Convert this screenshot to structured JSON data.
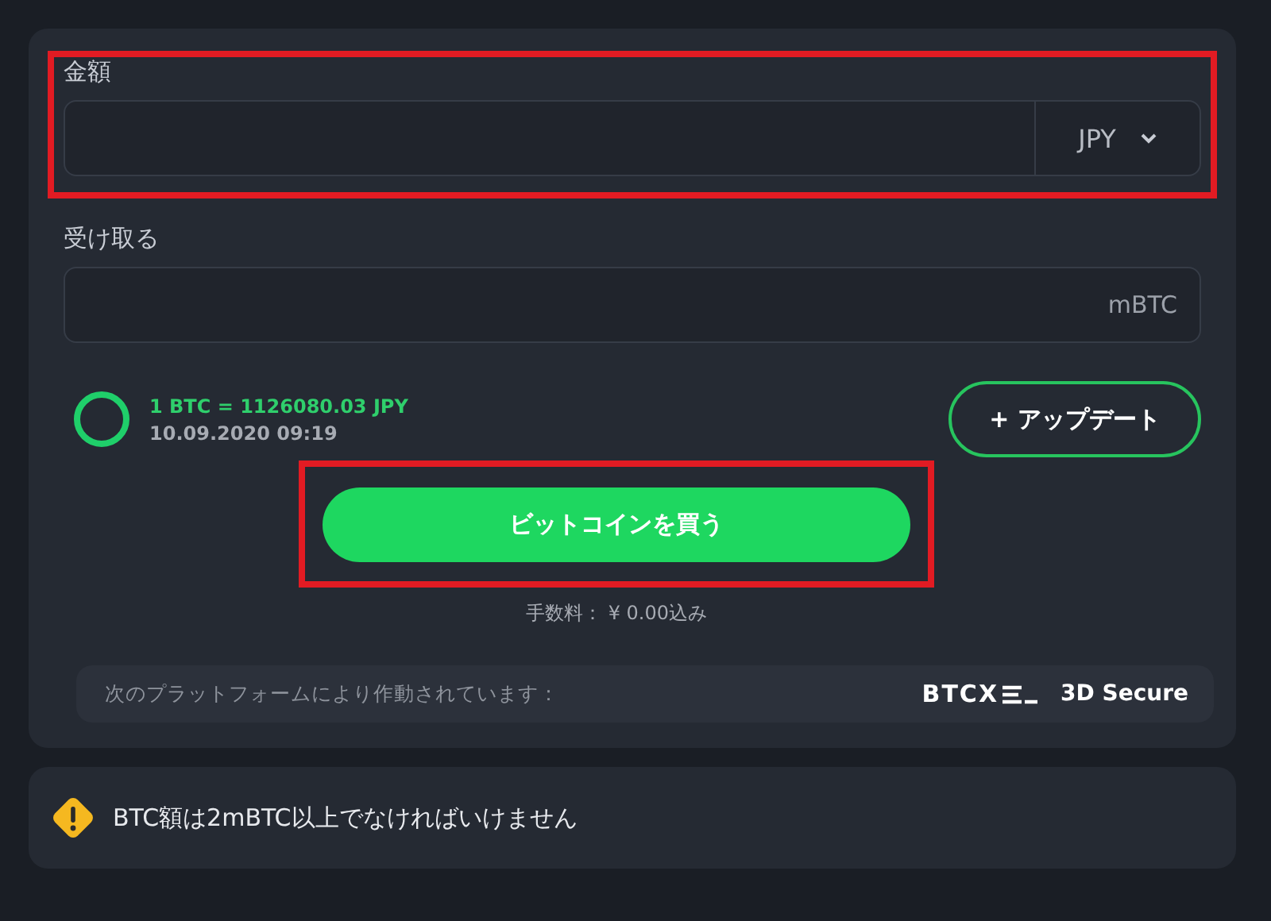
{
  "amount": {
    "label": "金額",
    "currency": "JPY",
    "highlighted": true
  },
  "receive": {
    "label": "受け取る",
    "unit": "mBTC"
  },
  "rate": {
    "text": "1 BTC = 1126080.03 JPY",
    "time": "10.09.2020 09:19"
  },
  "update_button": "+ アップデート",
  "buy_button": {
    "label": "ビットコインを買う",
    "highlighted": true
  },
  "fee": "手数料： ¥ 0.00込み",
  "platform": {
    "text": "次のプラットフォームにより作動されています：",
    "logo": "BTCX",
    "secure": "3D Secure"
  },
  "warning": "BTC額は2mBTC以上でなければいけません"
}
